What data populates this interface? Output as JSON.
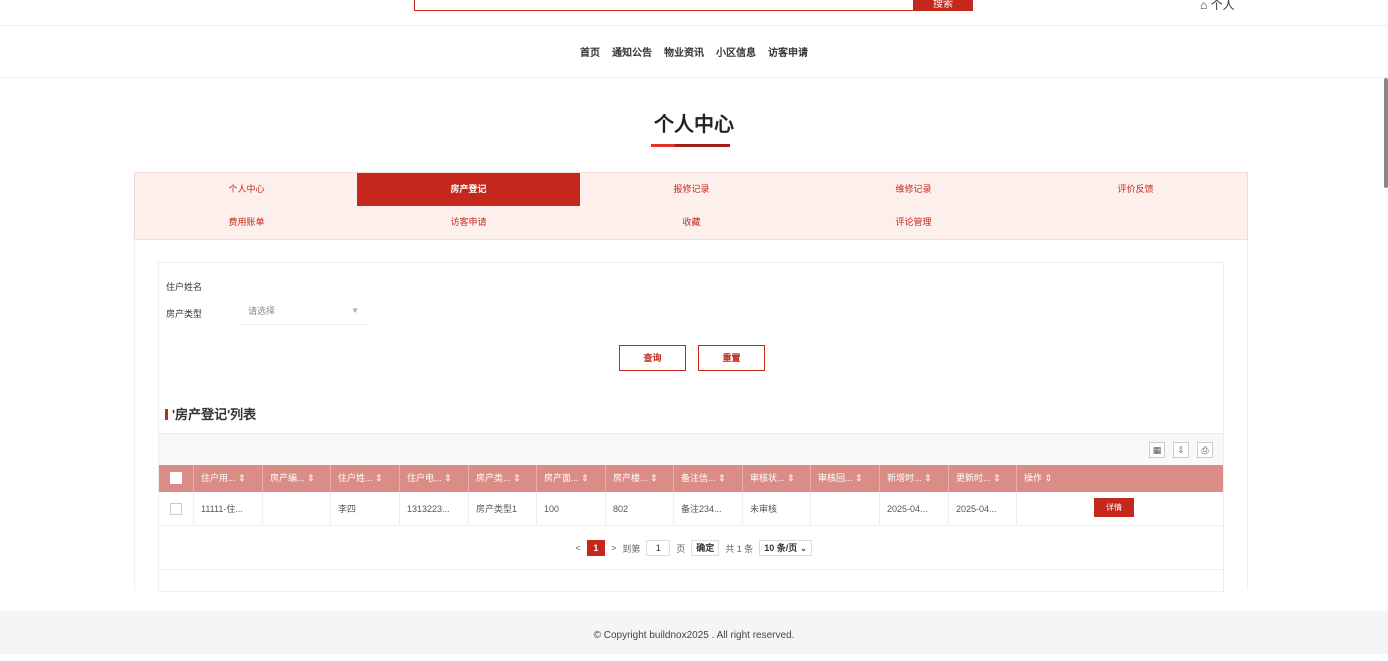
{
  "header": {
    "search_button": "搜索",
    "user_icon": "⌂",
    "user_label": "个人"
  },
  "nav": {
    "items": [
      "首页",
      "通知公告",
      "物业资讯",
      "小区信息",
      "访客申请"
    ]
  },
  "page_title": "个人中心",
  "tabs": [
    "个人中心",
    "房产登记",
    "报修记录",
    "维修记录",
    "评价反馈",
    "费用账单",
    "访客申请",
    "收藏",
    "评论管理"
  ],
  "filter": {
    "name_label": "住户姓名",
    "type_label": "房产类型",
    "type_placeholder": "请选择",
    "query_button": "查询",
    "reset_button": "重置"
  },
  "list_title": "'房产登记'列表",
  "table": {
    "headers": [
      "住户用... ⇕",
      "房产编... ⇕",
      "住户姓... ⇕",
      "住户电... ⇕",
      "房产类... ⇕",
      "房产面... ⇕",
      "房产楼... ⇕",
      "备注信... ⇕",
      "审核状... ⇕",
      "审核回... ⇕",
      "新增时... ⇕",
      "更新时... ⇕",
      "操作 ⇕"
    ],
    "rows": [
      [
        "11111-住...",
        "",
        "李四",
        "1313223...",
        "房产类型1",
        "100",
        "802",
        "备注234...",
        "未审核",
        "",
        "2025-04...",
        "2025-04..."
      ]
    ],
    "detail_button": "详情"
  },
  "pagination": {
    "prev": "<",
    "current": "1",
    "next": ">",
    "goto_label": "到第",
    "goto_value": "1",
    "page_unit": "页",
    "confirm": "确定",
    "total": "共 1 条",
    "page_size": "10 条/页 ⌄"
  },
  "footer": "© Copyright buildnox2025 . All right reserved."
}
